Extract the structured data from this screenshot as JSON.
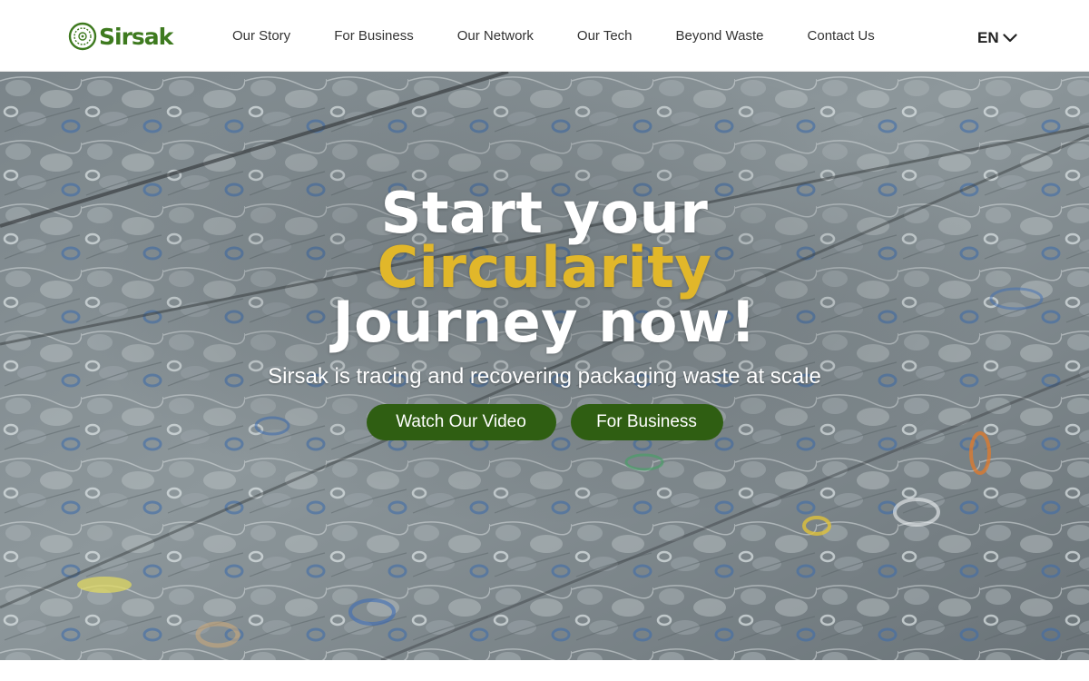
{
  "header": {
    "logo": {
      "text": "Sirsak",
      "icon": "sirsak-logo-icon"
    },
    "nav": [
      {
        "label": "Our Story"
      },
      {
        "label": "For Business"
      },
      {
        "label": "Our Network"
      },
      {
        "label": "Our Tech"
      },
      {
        "label": "Beyond Waste"
      },
      {
        "label": "Contact Us"
      }
    ],
    "language": {
      "label": "EN",
      "icon": "chevron-down-icon"
    }
  },
  "hero": {
    "title_line1": "Start your",
    "title_accent": "Circularity",
    "title_line3": "Journey now!",
    "subtitle": "Sirsak is tracing and recovering packaging waste at scale",
    "buttons": {
      "video_label": "Watch Our Video",
      "business_label": "For Business"
    },
    "background": "baled-plastic-bottles-photo"
  },
  "colors": {
    "brand_green": "#2f5e12",
    "logo_green": "#3e7a1f",
    "accent_yellow": "#e1b72a",
    "nav_text": "#333333"
  }
}
